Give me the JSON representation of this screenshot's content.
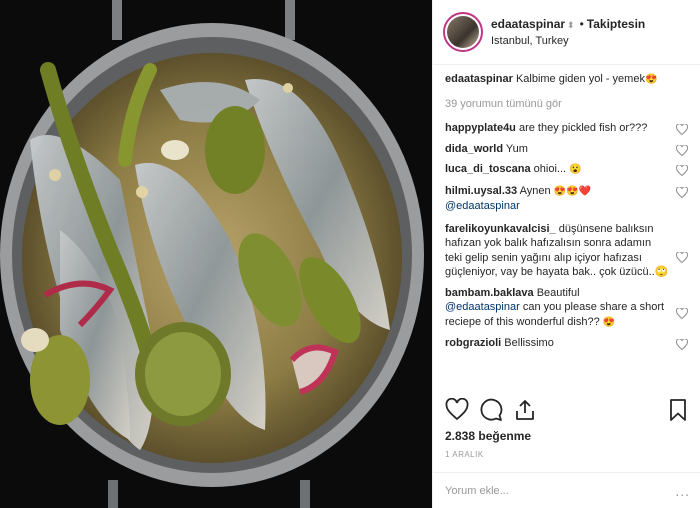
{
  "header": {
    "username": "edaataspinar",
    "separator": "•",
    "follow_status": "Takiptesin",
    "location": "Istanbul, Turkey"
  },
  "caption": {
    "username": "edaataspinar",
    "text": "Kalbime giden yol - yemek",
    "emoji": "😍"
  },
  "view_all": "39 yorumun tümünü gör",
  "comments": [
    {
      "user": "happyplate4u",
      "text": "are they pickled fish or???"
    },
    {
      "user": "dida_world",
      "text": "Yum"
    },
    {
      "user": "luca_di_toscana",
      "text": "ohioi...",
      "emoji": "😮"
    },
    {
      "user": "hilmi.uysal.33",
      "text": "Aynen",
      "emoji": "😍😍❤️",
      "mention": "@edaataspinar"
    },
    {
      "user": "farelikoyunkavalcisi_",
      "text": "düşünsene balıksın hafızan yok balık hafızalısın sonra adamın teki gelip senin yağını alıp içiyor hafızası güçleniyor, vay be hayata bak.. çok üzücü..🙄"
    },
    {
      "user": "bambam.baklava",
      "text": "Beautiful",
      "mention": "@edaataspinar",
      "text2": "can you please share a short reciepe of this wonderful dish??",
      "emoji": "😍"
    },
    {
      "user": "robgrazioli",
      "text": "Bellissimo"
    }
  ],
  "likes": "2.838 beğenme",
  "date": "1 ARALIK",
  "composer": {
    "placeholder": "Yorum ekle...",
    "more": "..."
  },
  "icons": [
    "heart-icon",
    "comment-icon",
    "share-icon",
    "bookmark-icon"
  ],
  "colors": {
    "text": "#262626",
    "muted": "#999999",
    "mention": "#003569",
    "border": "#efefef"
  }
}
